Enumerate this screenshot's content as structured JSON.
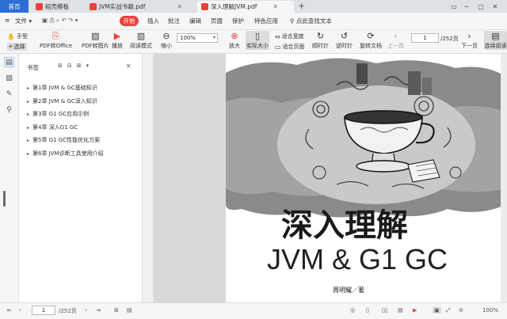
{
  "tabs": {
    "home": "首页",
    "items": [
      {
        "label": "稻壳模板",
        "color": "#e8423a"
      },
      {
        "label": "JVM实战书籍.pdf",
        "color": "#e8423a"
      },
      {
        "label": "深入理解JVM.pdf",
        "color": "#e8423a"
      }
    ]
  },
  "menu": {
    "file": "文件",
    "start": "开始",
    "items": [
      "插入",
      "批注",
      "编辑",
      "页面",
      "保护",
      "特色应用"
    ],
    "search": "点此查找文本"
  },
  "toolbar": {
    "hand": "手型",
    "select": "选择",
    "pdf_to_office": "PDF转Office",
    "pdf_to_image": "PDF转图片",
    "play": "播放",
    "read_mode": "阅读模式",
    "zoom_value": "100%",
    "zoom_out": "缩小",
    "zoom_in": "放大",
    "actual_size": "实际大小",
    "fit_width": "适合宽度",
    "fit_page": "适合页面",
    "rotate_cw": "顺时针",
    "rotate_ccw": "逆时针",
    "rotate_doc": "旋转文档",
    "prev_page": "上一页",
    "next_page": "下一页",
    "page_current": "1",
    "page_total": "/252页",
    "continuous": "连续阅读"
  },
  "bookmarks": {
    "title": "书签",
    "items": [
      "第1章 JVM & GC基础知识",
      "第2章 JVM & GC深入知识",
      "第3章 G1 GC应用示例",
      "第4章 深入G1 GC",
      "第5章 G1 GC性能优化方案",
      "第6章 JVM诊断工具使用介绍"
    ]
  },
  "page": {
    "title_cn": "深入理解",
    "title_en": "JVM & G1 GC",
    "author": "周明耀／著"
  },
  "status": {
    "page_current": "1",
    "page_total": "/252页",
    "zoom": "100%"
  }
}
